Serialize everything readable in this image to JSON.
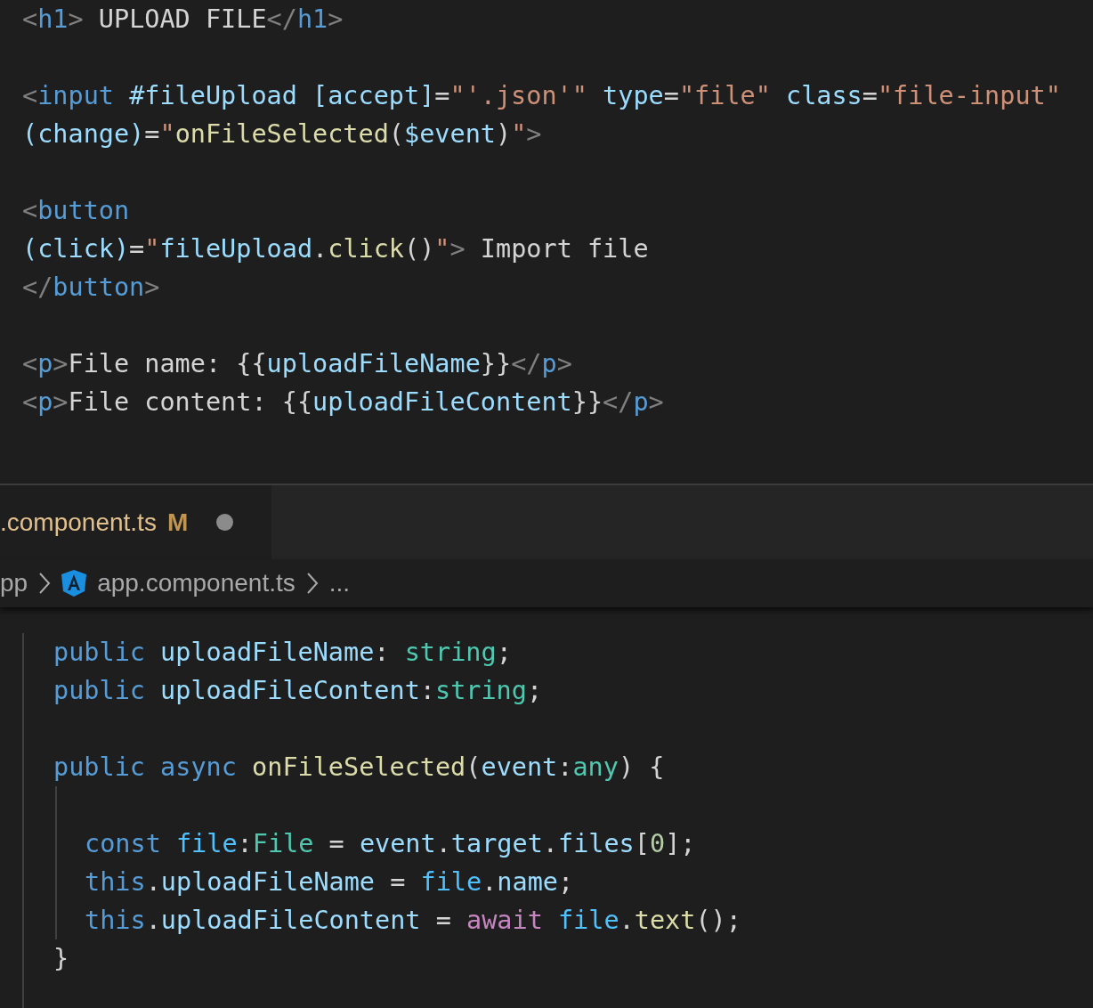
{
  "top_editor": {
    "blocks": [
      {
        "lines": [
          [
            {
              "kind": "punct",
              "text": "<"
            },
            {
              "kind": "tag",
              "text": "h1"
            },
            {
              "kind": "punct",
              "text": ">"
            },
            {
              "kind": "text",
              "text": " UPLOAD FILE"
            },
            {
              "kind": "punct",
              "text": "</"
            },
            {
              "kind": "tag",
              "text": "h1"
            },
            {
              "kind": "punct",
              "text": ">"
            }
          ]
        ]
      },
      {
        "lines": [
          [
            {
              "kind": "punct",
              "text": "<"
            },
            {
              "kind": "tag",
              "text": "input"
            },
            {
              "kind": "attr",
              "text": " #fileUpload [accept]"
            },
            {
              "kind": "text",
              "text": "="
            },
            {
              "kind": "str",
              "text": "\"'.json'\""
            },
            {
              "kind": "attr",
              "text": " type"
            },
            {
              "kind": "text",
              "text": "="
            },
            {
              "kind": "str",
              "text": "\"file\""
            },
            {
              "kind": "attr",
              "text": " class"
            },
            {
              "kind": "text",
              "text": "="
            },
            {
              "kind": "str",
              "text": "\"file-input\""
            }
          ],
          [
            {
              "kind": "attr",
              "text": "(change)"
            },
            {
              "kind": "text",
              "text": "="
            },
            {
              "kind": "str",
              "text": "\""
            },
            {
              "kind": "fn",
              "text": "onFileSelected"
            },
            {
              "kind": "text",
              "text": "("
            },
            {
              "kind": "var",
              "text": "$event"
            },
            {
              "kind": "text",
              "text": ")"
            },
            {
              "kind": "str",
              "text": "\""
            },
            {
              "kind": "punct",
              "text": ">"
            }
          ]
        ]
      },
      {
        "lines": [
          [
            {
              "kind": "punct",
              "text": "<"
            },
            {
              "kind": "tag",
              "text": "button"
            }
          ],
          [
            {
              "kind": "attr",
              "text": "(click)"
            },
            {
              "kind": "text",
              "text": "="
            },
            {
              "kind": "str",
              "text": "\""
            },
            {
              "kind": "var",
              "text": "fileUpload"
            },
            {
              "kind": "text",
              "text": "."
            },
            {
              "kind": "fn",
              "text": "click"
            },
            {
              "kind": "text",
              "text": "()"
            },
            {
              "kind": "str",
              "text": "\""
            },
            {
              "kind": "punct",
              "text": ">"
            },
            {
              "kind": "text",
              "text": " Import file"
            }
          ],
          [
            {
              "kind": "punct",
              "text": "</"
            },
            {
              "kind": "tag",
              "text": "button"
            },
            {
              "kind": "punct",
              "text": ">"
            }
          ]
        ]
      },
      {
        "lines": [
          [
            {
              "kind": "punct",
              "text": "<"
            },
            {
              "kind": "tag",
              "text": "p"
            },
            {
              "kind": "punct",
              "text": ">"
            },
            {
              "kind": "text",
              "text": "File name: {{"
            },
            {
              "kind": "var",
              "text": "uploadFileName"
            },
            {
              "kind": "text",
              "text": "}}"
            },
            {
              "kind": "punct",
              "text": "</"
            },
            {
              "kind": "tag",
              "text": "p"
            },
            {
              "kind": "punct",
              "text": ">"
            }
          ],
          [
            {
              "kind": "punct",
              "text": "<"
            },
            {
              "kind": "tag",
              "text": "p"
            },
            {
              "kind": "punct",
              "text": ">"
            },
            {
              "kind": "text",
              "text": "File content: {{"
            },
            {
              "kind": "var",
              "text": "uploadFileContent"
            },
            {
              "kind": "text",
              "text": "}}"
            },
            {
              "kind": "punct",
              "text": "</"
            },
            {
              "kind": "tag",
              "text": "p"
            },
            {
              "kind": "punct",
              "text": ">"
            }
          ]
        ]
      }
    ]
  },
  "tab": {
    "label": ".component.ts",
    "badge": "M",
    "modified": true,
    "selected": true
  },
  "breadcrumbs": [
    {
      "label": "pp",
      "kind": "folder"
    },
    {
      "label": "app.component.ts",
      "kind": "angular-file"
    },
    {
      "label": "...",
      "kind": "more"
    }
  ],
  "bottom_editor": {
    "blocks": [
      {
        "lines": [
          [
            {
              "kind": "kw",
              "text": "public"
            },
            {
              "kind": "var",
              "text": " uploadFileName"
            },
            {
              "kind": "text",
              "text": ": "
            },
            {
              "kind": "type",
              "text": "string"
            },
            {
              "kind": "text",
              "text": ";"
            }
          ],
          [
            {
              "kind": "kw",
              "text": "public"
            },
            {
              "kind": "var",
              "text": " uploadFileContent"
            },
            {
              "kind": "text",
              "text": ":"
            },
            {
              "kind": "type",
              "text": "string"
            },
            {
              "kind": "text",
              "text": ";"
            }
          ]
        ]
      },
      {
        "lines": [
          [
            {
              "kind": "kw",
              "text": "public async"
            },
            {
              "kind": "fn",
              "text": " onFileSelected"
            },
            {
              "kind": "text",
              "text": "("
            },
            {
              "kind": "var",
              "text": "event"
            },
            {
              "kind": "text",
              "text": ":"
            },
            {
              "kind": "type",
              "text": "any"
            },
            {
              "kind": "text",
              "text": ") {"
            }
          ]
        ],
        "children": [
          [
            {
              "kind": "kw",
              "text": "const"
            },
            {
              "kind": "const",
              "text": " file"
            },
            {
              "kind": "text",
              "text": ":"
            },
            {
              "kind": "type",
              "text": "File"
            },
            {
              "kind": "text",
              "text": " = "
            },
            {
              "kind": "var",
              "text": "event"
            },
            {
              "kind": "text",
              "text": "."
            },
            {
              "kind": "var",
              "text": "target"
            },
            {
              "kind": "text",
              "text": "."
            },
            {
              "kind": "var",
              "text": "files"
            },
            {
              "kind": "text",
              "text": "["
            },
            {
              "kind": "num",
              "text": "0"
            },
            {
              "kind": "text",
              "text": "];"
            }
          ],
          [
            {
              "kind": "kw",
              "text": "this"
            },
            {
              "kind": "text",
              "text": "."
            },
            {
              "kind": "var",
              "text": "uploadFileName"
            },
            {
              "kind": "text",
              "text": " = "
            },
            {
              "kind": "const",
              "text": "file"
            },
            {
              "kind": "text",
              "text": "."
            },
            {
              "kind": "var",
              "text": "name"
            },
            {
              "kind": "text",
              "text": ";"
            }
          ],
          [
            {
              "kind": "kw",
              "text": "this"
            },
            {
              "kind": "text",
              "text": "."
            },
            {
              "kind": "var",
              "text": "uploadFileContent"
            },
            {
              "kind": "text",
              "text": " = "
            },
            {
              "kind": "ctrl",
              "text": "await"
            },
            {
              "kind": "const",
              "text": " file"
            },
            {
              "kind": "text",
              "text": "."
            },
            {
              "kind": "fn",
              "text": "text"
            },
            {
              "kind": "text",
              "text": "();"
            }
          ]
        ],
        "closing": [
          {
            "kind": "text",
            "text": "}"
          }
        ]
      }
    ]
  }
}
